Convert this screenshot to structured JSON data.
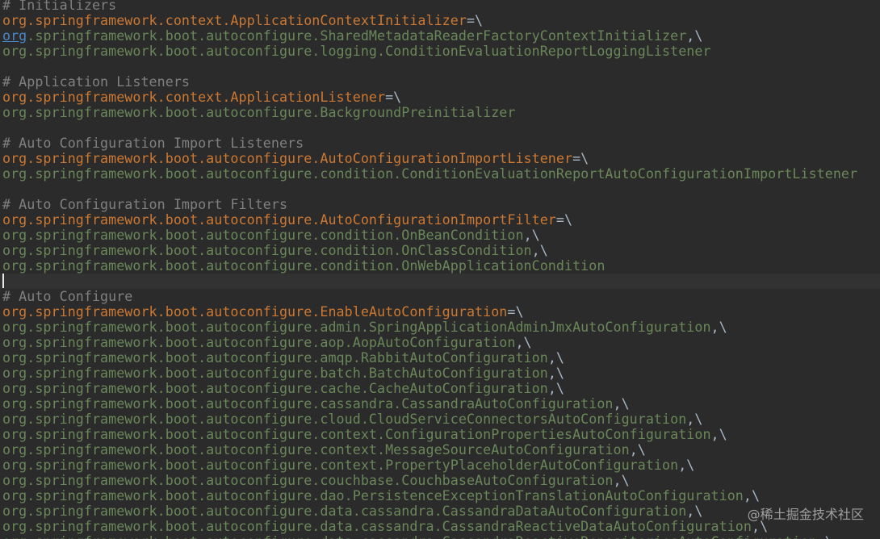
{
  "editor": {
    "lines": [
      {
        "type": "comment",
        "text": "# Initializers"
      },
      {
        "type": "key",
        "text": "org.springframework.context.ApplicationContextInitializer",
        "suffix": "=\\"
      },
      {
        "type": "value_linked",
        "prefix": "org",
        "text": ".springframework.boot.autoconfigure.SharedMetadataReaderFactoryContextInitializer",
        "suffix": ",\\"
      },
      {
        "type": "value",
        "text": "org.springframework.boot.autoconfigure.logging.ConditionEvaluationReportLoggingListener",
        "suffix": ""
      },
      {
        "type": "blank",
        "text": ""
      },
      {
        "type": "comment",
        "text": "# Application Listeners"
      },
      {
        "type": "key",
        "text": "org.springframework.context.ApplicationListener",
        "suffix": "=\\"
      },
      {
        "type": "value",
        "text": "org.springframework.boot.autoconfigure.BackgroundPreinitializer",
        "suffix": ""
      },
      {
        "type": "blank",
        "text": ""
      },
      {
        "type": "comment",
        "text": "# Auto Configuration Import Listeners"
      },
      {
        "type": "key",
        "text": "org.springframework.boot.autoconfigure.AutoConfigurationImportListener",
        "suffix": "=\\"
      },
      {
        "type": "value",
        "text": "org.springframework.boot.autoconfigure.condition.ConditionEvaluationReportAutoConfigurationImportListener",
        "suffix": ""
      },
      {
        "type": "blank",
        "text": ""
      },
      {
        "type": "comment",
        "text": "# Auto Configuration Import Filters"
      },
      {
        "type": "key",
        "text": "org.springframework.boot.autoconfigure.AutoConfigurationImportFilter",
        "suffix": "=\\"
      },
      {
        "type": "value",
        "text": "org.springframework.boot.autoconfigure.condition.OnBeanCondition",
        "suffix": ",\\"
      },
      {
        "type": "value",
        "text": "org.springframework.boot.autoconfigure.condition.OnClassCondition",
        "suffix": ",\\"
      },
      {
        "type": "value",
        "text": "org.springframework.boot.autoconfigure.condition.OnWebApplicationCondition",
        "suffix": ""
      },
      {
        "type": "cursor",
        "text": ""
      },
      {
        "type": "comment",
        "text": "# Auto Configure"
      },
      {
        "type": "key",
        "text": "org.springframework.boot.autoconfigure.EnableAutoConfiguration",
        "suffix": "=\\"
      },
      {
        "type": "value",
        "text": "org.springframework.boot.autoconfigure.admin.SpringApplicationAdminJmxAutoConfiguration",
        "suffix": ",\\"
      },
      {
        "type": "value",
        "text": "org.springframework.boot.autoconfigure.aop.AopAutoConfiguration",
        "suffix": ",\\"
      },
      {
        "type": "value",
        "text": "org.springframework.boot.autoconfigure.amqp.RabbitAutoConfiguration",
        "suffix": ",\\"
      },
      {
        "type": "value",
        "text": "org.springframework.boot.autoconfigure.batch.BatchAutoConfiguration",
        "suffix": ",\\"
      },
      {
        "type": "value",
        "text": "org.springframework.boot.autoconfigure.cache.CacheAutoConfiguration",
        "suffix": ",\\"
      },
      {
        "type": "value",
        "text": "org.springframework.boot.autoconfigure.cassandra.CassandraAutoConfiguration",
        "suffix": ",\\"
      },
      {
        "type": "value",
        "text": "org.springframework.boot.autoconfigure.cloud.CloudServiceConnectorsAutoConfiguration",
        "suffix": ",\\"
      },
      {
        "type": "value",
        "text": "org.springframework.boot.autoconfigure.context.ConfigurationPropertiesAutoConfiguration",
        "suffix": ",\\"
      },
      {
        "type": "value",
        "text": "org.springframework.boot.autoconfigure.context.MessageSourceAutoConfiguration",
        "suffix": ",\\"
      },
      {
        "type": "value",
        "text": "org.springframework.boot.autoconfigure.context.PropertyPlaceholderAutoConfiguration",
        "suffix": ",\\"
      },
      {
        "type": "value",
        "text": "org.springframework.boot.autoconfigure.couchbase.CouchbaseAutoConfiguration",
        "suffix": ",\\"
      },
      {
        "type": "value",
        "text": "org.springframework.boot.autoconfigure.dao.PersistenceExceptionTranslationAutoConfiguration",
        "suffix": ",\\"
      },
      {
        "type": "value",
        "text": "org.springframework.boot.autoconfigure.data.cassandra.CassandraDataAutoConfiguration",
        "suffix": ",\\"
      },
      {
        "type": "value",
        "text": "org.springframework.boot.autoconfigure.data.cassandra.CassandraReactiveDataAutoConfiguration",
        "suffix": ",\\"
      },
      {
        "type": "value",
        "text": "org.springframework.boot.autoconfigure.data.cassandra.CassandraReactiveRepositoriesAutoConfiguration",
        "suffix": ",\\"
      }
    ]
  },
  "watermark": {
    "text": "@稀土掘金技术社区"
  },
  "colors": {
    "background": "#2b2b2b",
    "comment": "#808080",
    "key": "#cc7832",
    "value": "#6a8759",
    "operator": "#a9b7c6",
    "link": "#4a88c7"
  }
}
